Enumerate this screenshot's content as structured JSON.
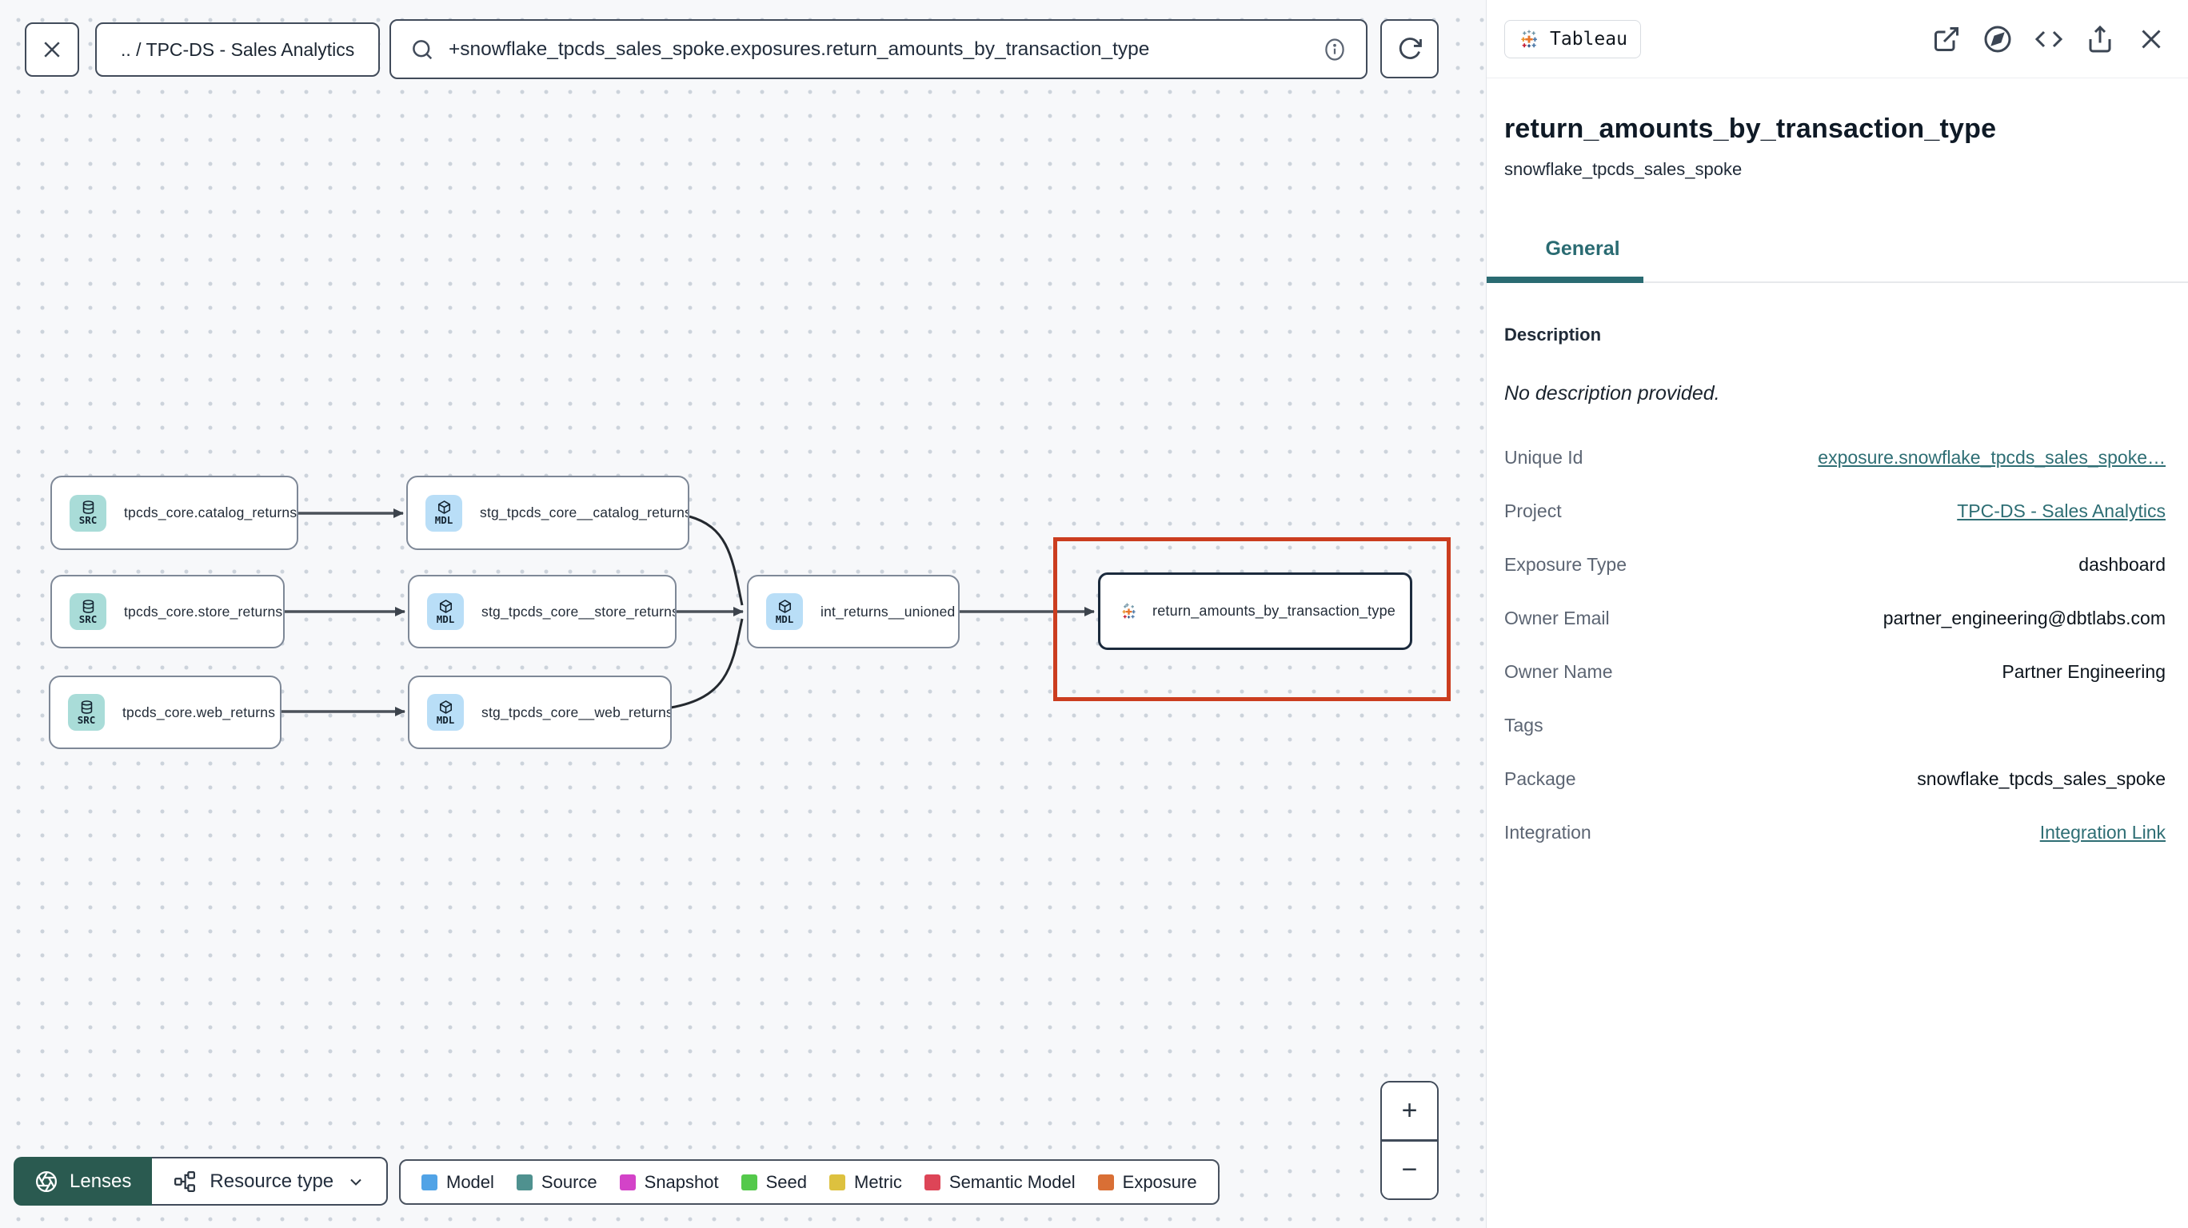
{
  "toolbar": {
    "close_label": "close",
    "breadcrumb": ".. / TPC-DS - Sales Analytics",
    "search_value": "+snowflake_tpcds_sales_spoke.exposures.return_amounts_by_transaction_type"
  },
  "graph": {
    "nodes": [
      {
        "badge": "SRC",
        "label": "tpcds_core.catalog_returns"
      },
      {
        "badge": "SRC",
        "label": "tpcds_core.store_returns"
      },
      {
        "badge": "SRC",
        "label": "tpcds_core.web_returns"
      },
      {
        "badge": "MDL",
        "label": "stg_tpcds_core__catalog_returns"
      },
      {
        "badge": "MDL",
        "label": "stg_tpcds_core__store_returns"
      },
      {
        "badge": "MDL",
        "label": "stg_tpcds_core__web_returns"
      },
      {
        "badge": "MDL",
        "label": "int_returns__unioned"
      },
      {
        "badge": "tableau-logo",
        "label": "return_amounts_by_transaction_type"
      }
    ]
  },
  "controls": {
    "lenses_label": "Lenses",
    "resource_type_label": "Resource type",
    "zoom_in": "+",
    "zoom_out": "−"
  },
  "legend": {
    "items": [
      {
        "label": "Model",
        "color": "#51a3e6"
      },
      {
        "label": "Source",
        "color": "#4f918f"
      },
      {
        "label": "Snapshot",
        "color": "#d343c8"
      },
      {
        "label": "Seed",
        "color": "#54c94b"
      },
      {
        "label": "Metric",
        "color": "#ddc13f"
      },
      {
        "label": "Semantic Model",
        "color": "#dd4557"
      },
      {
        "label": "Exposure",
        "color": "#d96f35"
      }
    ]
  },
  "panel": {
    "integration_chip": "Tableau",
    "title": "return_amounts_by_transaction_type",
    "subtitle": "snowflake_tpcds_sales_spoke",
    "tabs": [
      {
        "label": "General"
      }
    ],
    "description_header": "Description",
    "description_empty": "No description provided.",
    "rows": [
      {
        "label": "Unique Id",
        "value": "exposure.snowflake_tpcds_sales_spoke…",
        "link": true
      },
      {
        "label": "Project",
        "value": "TPC-DS - Sales Analytics",
        "link": true
      },
      {
        "label": "Exposure Type",
        "value": "dashboard",
        "link": false
      },
      {
        "label": "Owner Email",
        "value": "partner_engineering@dbtlabs.com",
        "link": false
      },
      {
        "label": "Owner Name",
        "value": "Partner Engineering",
        "link": false
      },
      {
        "label": "Tags",
        "value": "",
        "link": false
      },
      {
        "label": "Package",
        "value": "snowflake_tpcds_sales_spoke",
        "link": false
      },
      {
        "label": "Integration",
        "value": "Integration Link",
        "link": true
      }
    ]
  },
  "colors": {
    "accent_teal": "#2a6b72",
    "link_teal": "#2e6e74",
    "lenses_green": "#2a5a50",
    "selection_red": "#cb3d1f",
    "src_badge_bg": "#a9dcd8",
    "mdl_badge_bg": "#b9def7"
  }
}
